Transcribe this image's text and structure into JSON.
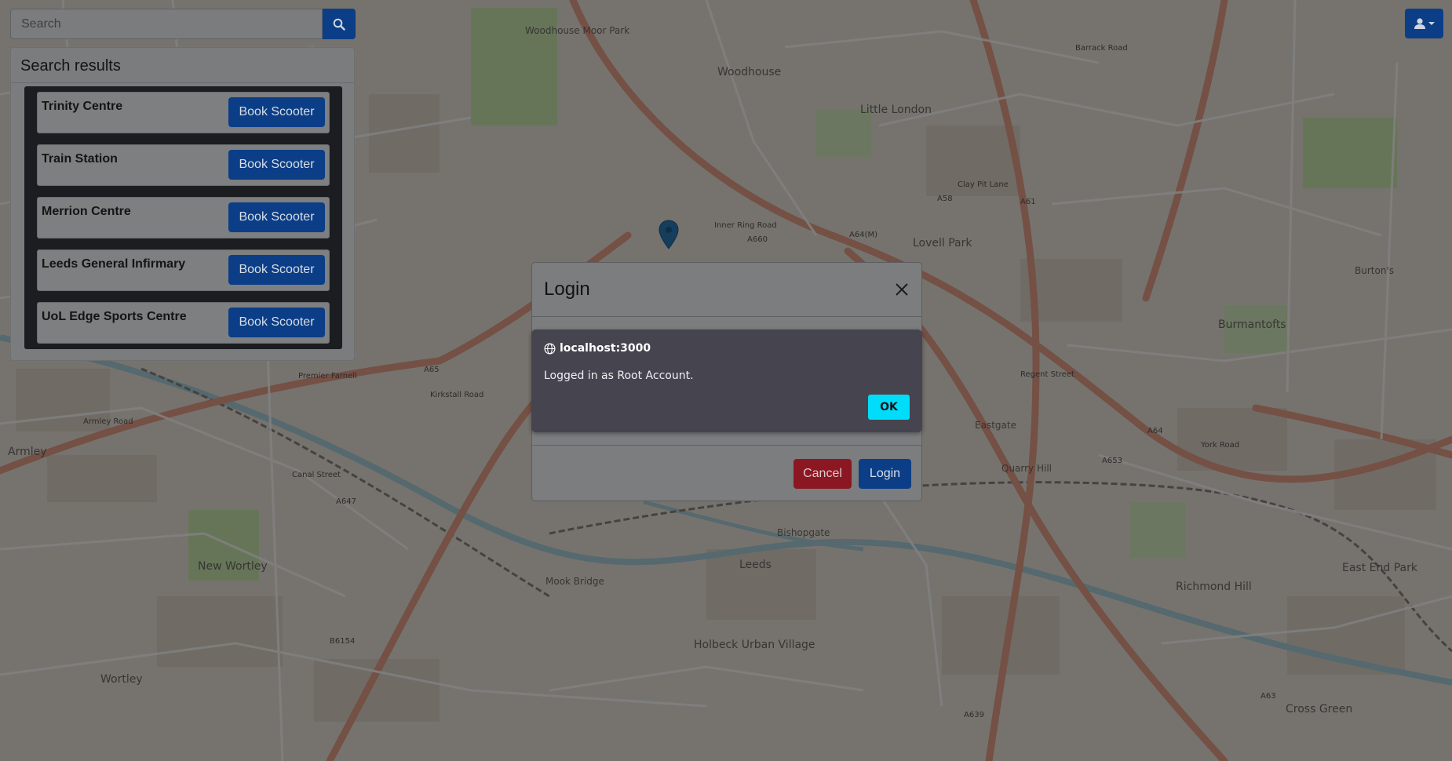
{
  "search": {
    "placeholder": "Search"
  },
  "results": {
    "title": "Search results",
    "items": [
      {
        "name": "Trinity Centre",
        "button_label": "Book Scooter"
      },
      {
        "name": "Train Station",
        "button_label": "Book Scooter"
      },
      {
        "name": "Merrion Centre",
        "button_label": "Book Scooter"
      },
      {
        "name": "Leeds General Infirmary",
        "button_label": "Book Scooter"
      },
      {
        "name": "UoL Edge Sports Centre",
        "button_label": "Book Scooter"
      }
    ]
  },
  "user_menu": {
    "icon": "user-icon"
  },
  "login_modal": {
    "title": "Login",
    "cancel_label": "Cancel",
    "login_label": "Login"
  },
  "alert": {
    "origin": "localhost:3000",
    "message": "Logged in as Root Account.",
    "ok_label": "OK"
  },
  "map": {
    "labels": [
      "Woodhouse Moor Park",
      "Woodhouse",
      "Little London",
      "Lovell Park",
      "Burmantofts",
      "Armley",
      "New Wortley",
      "Wortley",
      "Holbeck Urban Village",
      "Leeds",
      "Richmond Hill",
      "East End Park",
      "Cross Green",
      "Quarry Hill",
      "Eastgate",
      "Bishopgate",
      "Mook Bridge",
      "Inner Ring Road",
      "Armley Road",
      "Canal Street",
      "Kirkstall Road",
      "York Road",
      "Regent Street",
      "Burton's",
      "Premier Farnell",
      "Barrack Road",
      "Clay Pit Lane",
      "A58",
      "A61",
      "A64(M)",
      "A65",
      "A647",
      "A660",
      "A653",
      "A639",
      "A64",
      "A63",
      "B6154"
    ],
    "colors": {
      "land": "#ede7dd",
      "major_road": "#e8a08a",
      "river": "#aad3df",
      "park": "#cdebb0",
      "overlay": "rgba(0,0,0,0.5)"
    }
  }
}
